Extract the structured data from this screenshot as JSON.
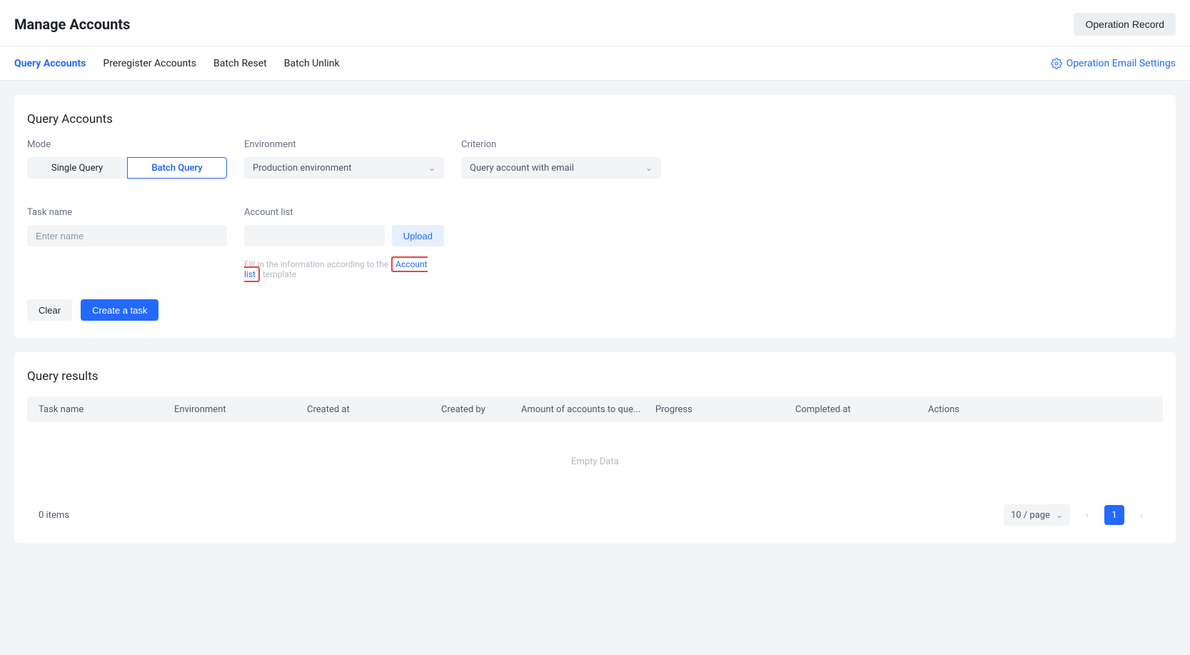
{
  "header": {
    "title": "Manage Accounts",
    "operation_record": "Operation Record"
  },
  "tabs": {
    "items": [
      {
        "label": "Query Accounts",
        "active": true
      },
      {
        "label": "Preregister Accounts",
        "active": false
      },
      {
        "label": "Batch Reset",
        "active": false
      },
      {
        "label": "Batch Unlink",
        "active": false
      }
    ],
    "settings_label": "Operation Email Settings"
  },
  "form": {
    "section_title": "Query Accounts",
    "mode": {
      "label": "Mode",
      "single": "Single Query",
      "batch": "Batch Query"
    },
    "environment": {
      "label": "Environment",
      "value": "Production environment"
    },
    "criterion": {
      "label": "Criterion",
      "value": "Query account with email"
    },
    "task_name": {
      "label": "Task name",
      "placeholder": "Enter name"
    },
    "account_list": {
      "label": "Account list",
      "upload_label": "Upload",
      "hint_prefix": "Fill in the information according to the",
      "hint_link": "Account list",
      "hint_suffix": "template"
    },
    "actions": {
      "clear": "Clear",
      "create": "Create a task"
    }
  },
  "results": {
    "title": "Query results",
    "columns": {
      "task_name": "Task name",
      "environment": "Environment",
      "created_at": "Created at",
      "created_by": "Created by",
      "amount": "Amount of accounts to que...",
      "progress": "Progress",
      "completed_at": "Completed at",
      "actions": "Actions"
    },
    "empty": "Empty Data",
    "count": "0 items",
    "page_size": "10 / page",
    "current_page": "1"
  }
}
